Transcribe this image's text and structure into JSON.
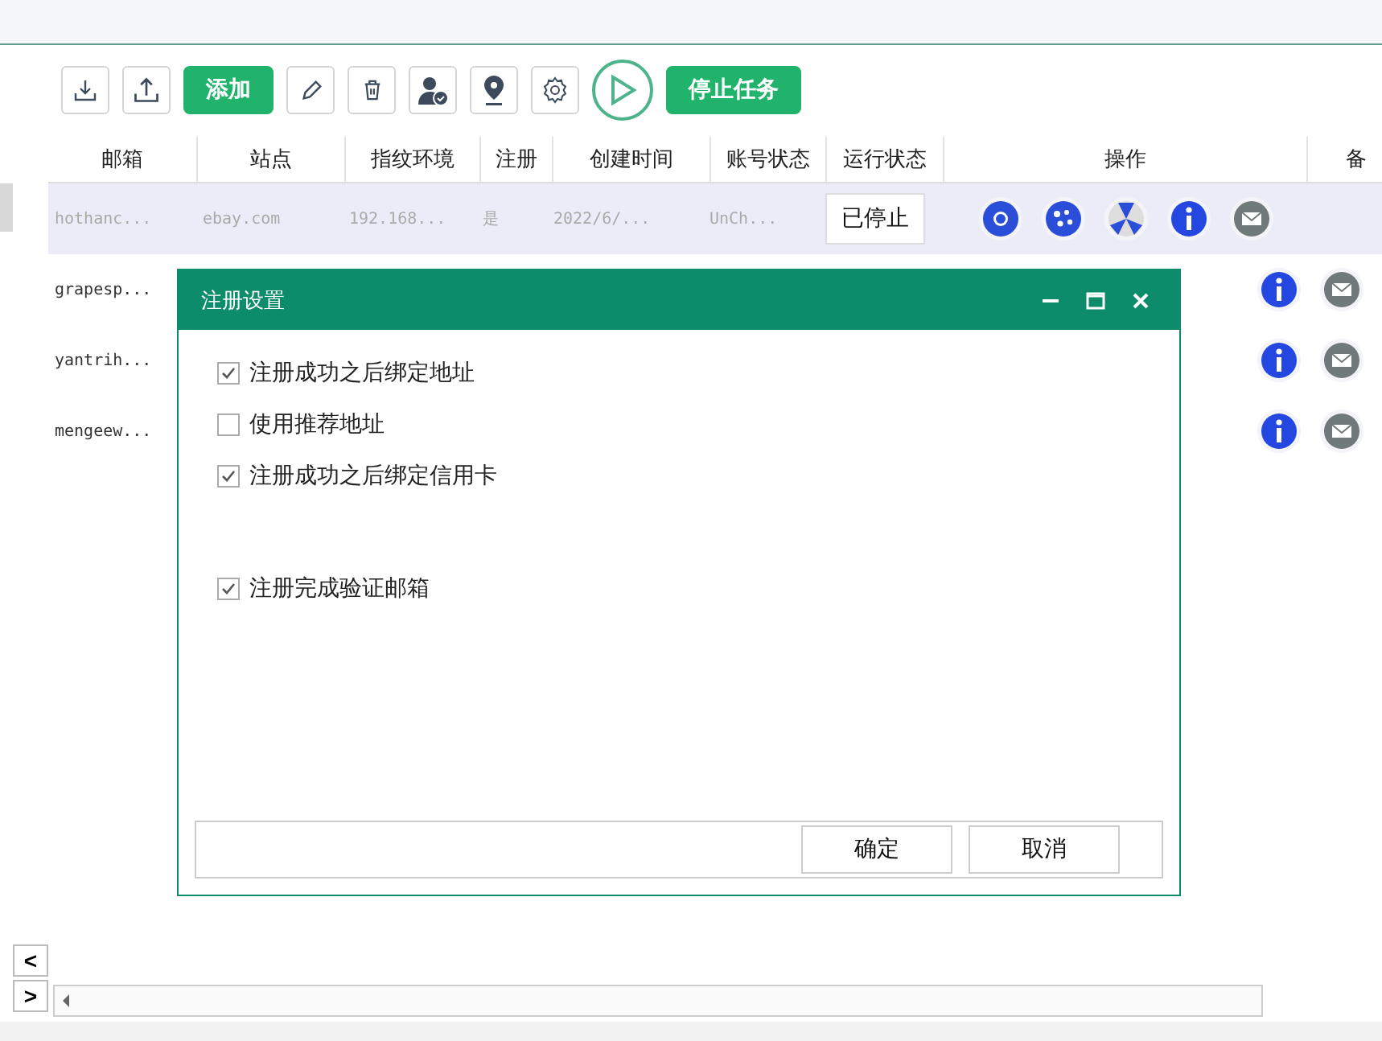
{
  "toolbar": [
    {
      "kind": "download"
    },
    {
      "kind": "upload"
    },
    {
      "kind": "button",
      "label": "添加"
    },
    {
      "kind": "pencil"
    },
    {
      "kind": "trash"
    },
    {
      "kind": "user"
    },
    {
      "kind": "pin"
    },
    {
      "kind": "gear"
    },
    {
      "kind": "play"
    },
    {
      "kind": "button",
      "label": "停止任务"
    }
  ],
  "table": {
    "columns": [
      "邮箱",
      "站点",
      "指纹环境",
      "注册",
      "创建时间",
      "账号状态",
      "运行状态",
      "操作",
      "备"
    ],
    "rows": [
      {
        "selected": true,
        "cells": [
          "hothanc...",
          "ebay.com",
          "192.168...",
          "是",
          "2022/6/...",
          "UnCh..."
        ],
        "status": "已停止"
      },
      {
        "selected": false,
        "cells": [
          "grapesp..."
        ]
      },
      {
        "selected": false,
        "cells": [
          "yantrih..."
        ]
      },
      {
        "selected": false,
        "cells": [
          "mengeew..."
        ]
      }
    ]
  },
  "dialog": {
    "title": "注册设置",
    "option_groups": [
      [
        {
          "label": "注册成功之后绑定地址",
          "checked": true
        },
        {
          "label": "使用推荐地址",
          "checked": false
        },
        {
          "label": "注册成功之后绑定信用卡",
          "checked": true
        }
      ],
      [
        {
          "label": "注册完成验证邮箱",
          "checked": true
        }
      ]
    ],
    "buttons": [
      "确定",
      "取消"
    ]
  },
  "pager": {
    "prev": "<",
    "next": ">"
  }
}
